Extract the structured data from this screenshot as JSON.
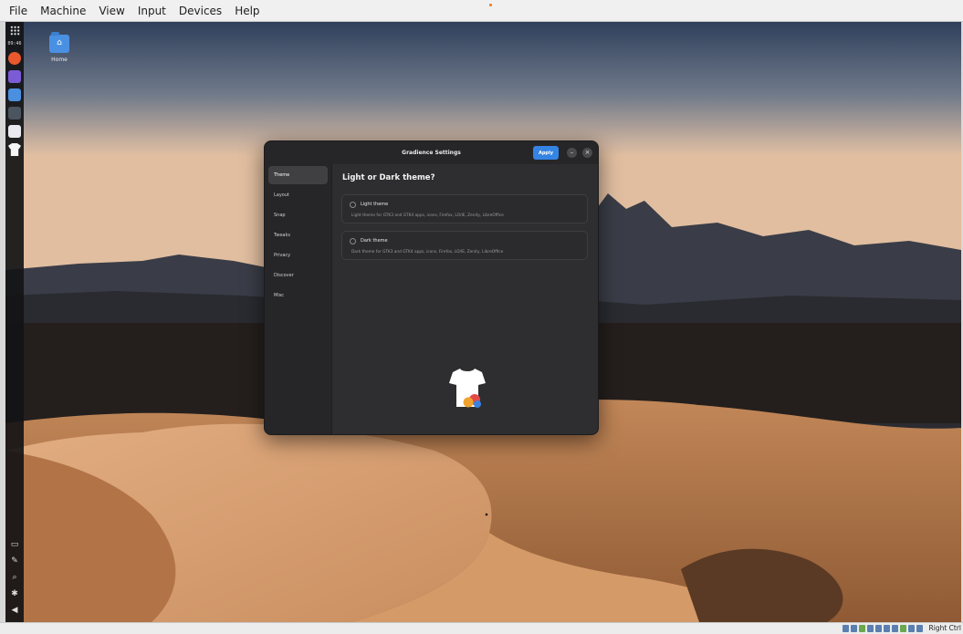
{
  "host": {
    "menus": [
      "File",
      "Machine",
      "View",
      "Input",
      "Devices",
      "Help"
    ],
    "status_text": "Right Ctrl"
  },
  "dock": {
    "time": "09:46",
    "apps": [
      {
        "name": "firefox-icon",
        "color": "#e8582c"
      },
      {
        "name": "mail-icon",
        "color": "#7c5cd6"
      },
      {
        "name": "files-icon",
        "color": "#4a8fe0"
      },
      {
        "name": "terminal-icon",
        "color": "#4b5560"
      },
      {
        "name": "text-editor-icon",
        "color": "#e9e9ef"
      },
      {
        "name": "theme-settings-icon",
        "color": "#f5f5f5"
      }
    ]
  },
  "desktop": {
    "icons": [
      {
        "label": "Home",
        "icon": "home-folder-icon"
      }
    ]
  },
  "window": {
    "title": "Gradience Settings",
    "apply_label": "Apply",
    "sidebar": [
      "Theme",
      "Layout",
      "Snap",
      "Tweaks",
      "Privacy",
      "Discover",
      "Misc"
    ],
    "active_index": 0,
    "heading": "Light or Dark theme?",
    "options": [
      {
        "name": "Light theme",
        "desc": "Light theme for GTK3 and GTK4 apps, icons, Firefox, LO/IE, Zenity, LibreOffice"
      },
      {
        "name": "Dark theme",
        "desc": "Dark theme for GTK3 and GTK4 apps, icons, Firefox, LO/IE, Zenity, LibreOffice"
      }
    ]
  },
  "colors": {
    "accent": "#3584e4",
    "window_bg": "#2e2e30"
  }
}
